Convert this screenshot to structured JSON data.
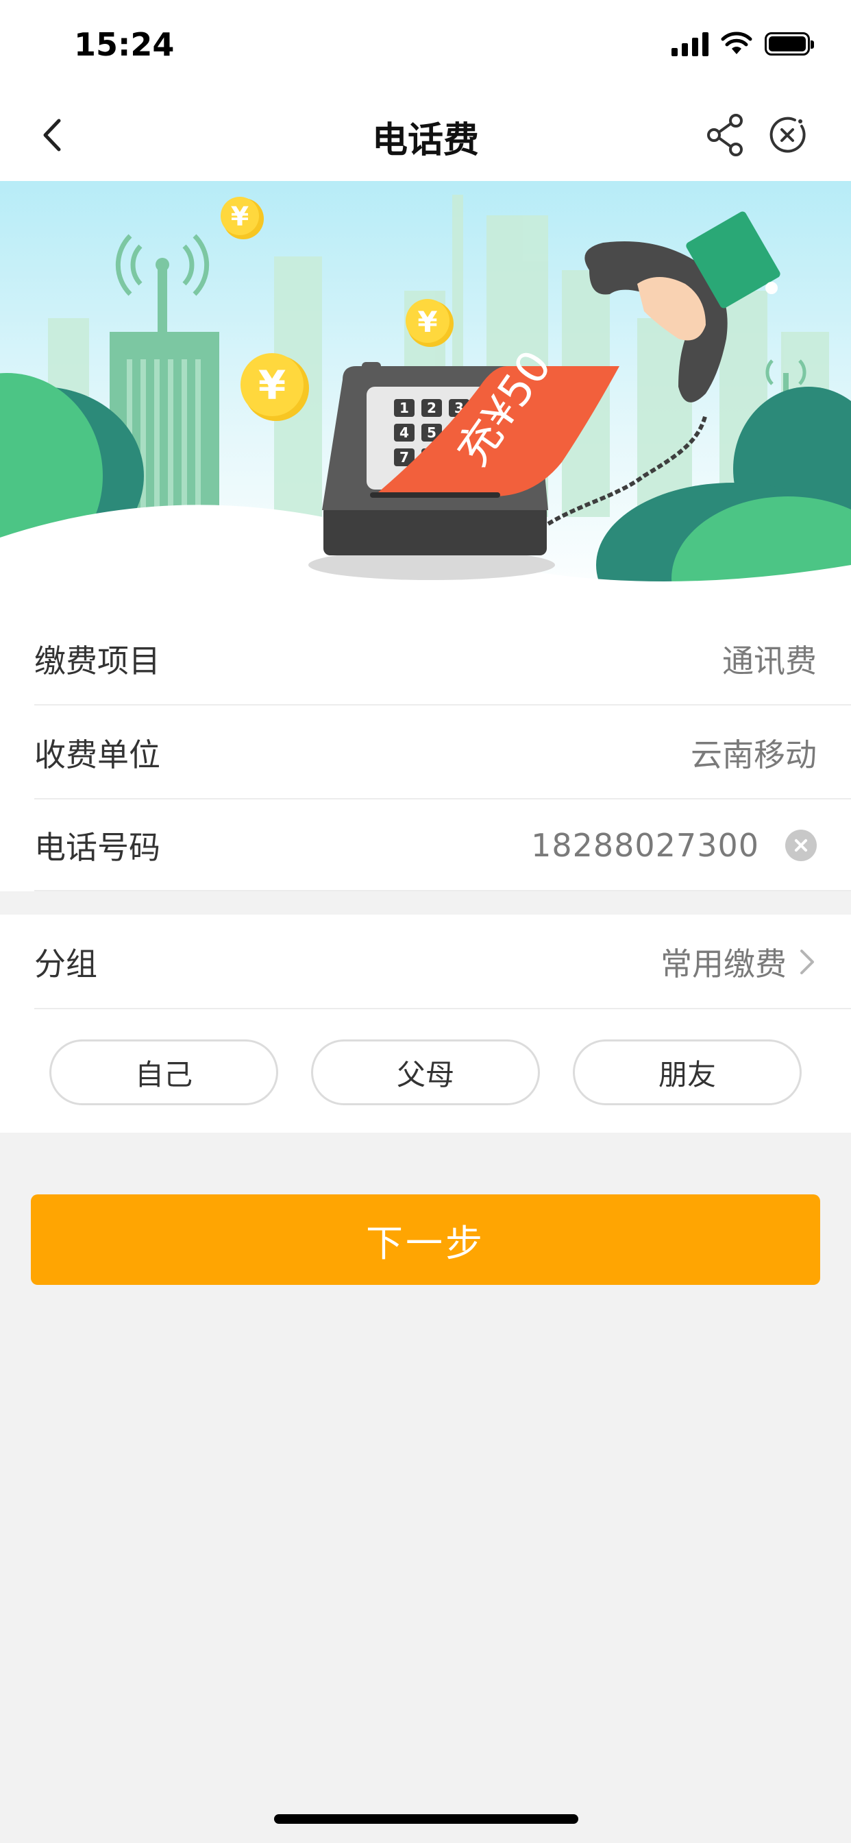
{
  "status_bar": {
    "time": "15:24"
  },
  "nav": {
    "title": "电话费"
  },
  "banner": {
    "ticket_text": "充¥50"
  },
  "form": {
    "rows": [
      {
        "label": "缴费项目",
        "value": "通讯费"
      },
      {
        "label": "收费单位",
        "value": "云南移动"
      },
      {
        "label": "电话号码",
        "value": "18288027300"
      }
    ]
  },
  "group": {
    "label": "分组",
    "value": "常用缴费",
    "chips": [
      "自己",
      "父母",
      "朋友"
    ]
  },
  "next_button": {
    "label": "下一步"
  },
  "colors": {
    "accent": "#ffa502",
    "banner_sky": "#bdeef8",
    "leaf": "#4cc585"
  }
}
